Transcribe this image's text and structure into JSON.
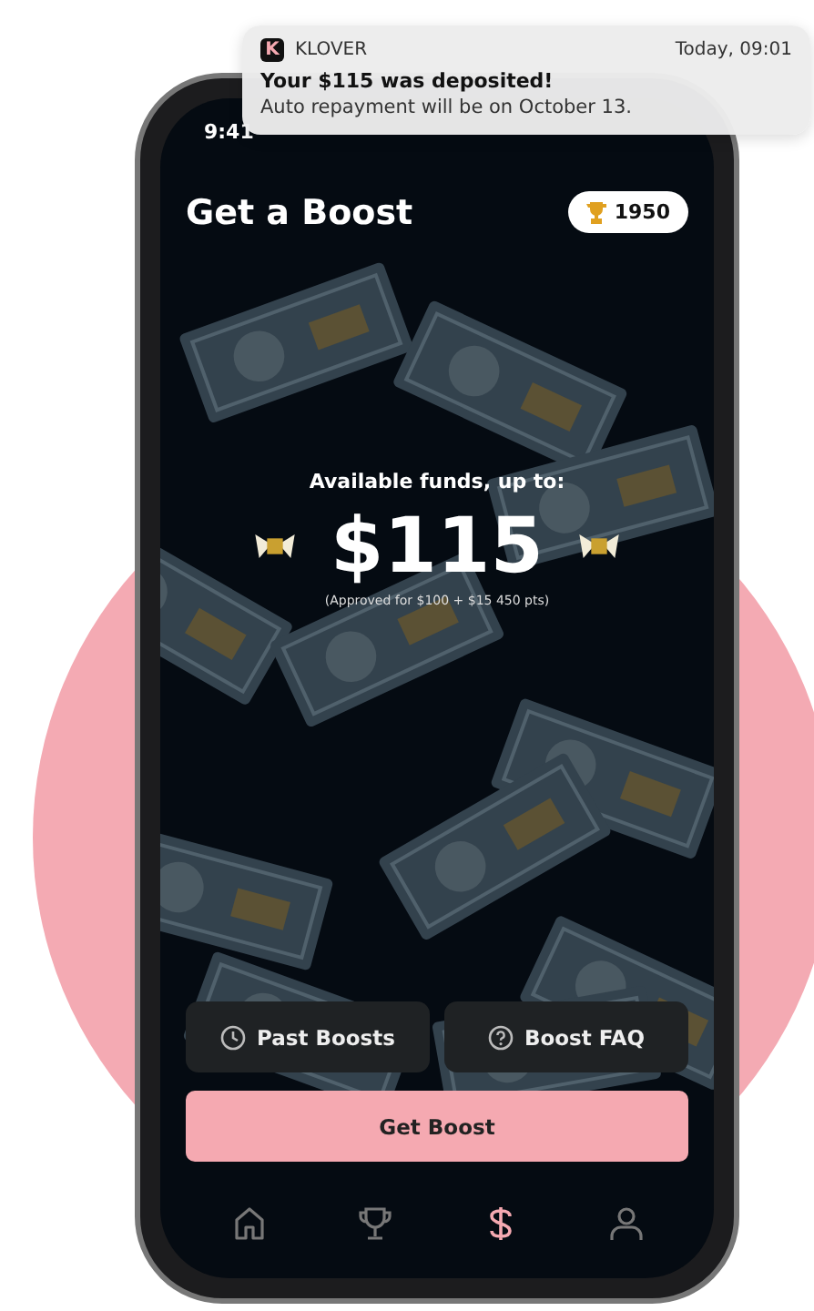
{
  "notification": {
    "app": "KLOVER",
    "app_initial": "K",
    "time": "Today, 09:01",
    "title": "Your $115 was deposited!",
    "body": "Auto repayment will be on October 13."
  },
  "status_bar": {
    "time": "9:41"
  },
  "header": {
    "title": "Get a Boost",
    "points": "1950"
  },
  "funds": {
    "label": "Available funds, up to:",
    "amount": "$115",
    "note": "(Approved for $100 + $15 450 pts)"
  },
  "actions": [
    {
      "kind": "history",
      "label": "Past Boosts"
    },
    {
      "kind": "faq",
      "label": "Boost FAQ"
    }
  ],
  "primary_button": "Get Boost",
  "nav": [
    {
      "kind": "home",
      "selected": false
    },
    {
      "kind": "trophy",
      "selected": false
    },
    {
      "kind": "dollar",
      "selected": true
    },
    {
      "kind": "profile",
      "selected": false
    }
  ]
}
